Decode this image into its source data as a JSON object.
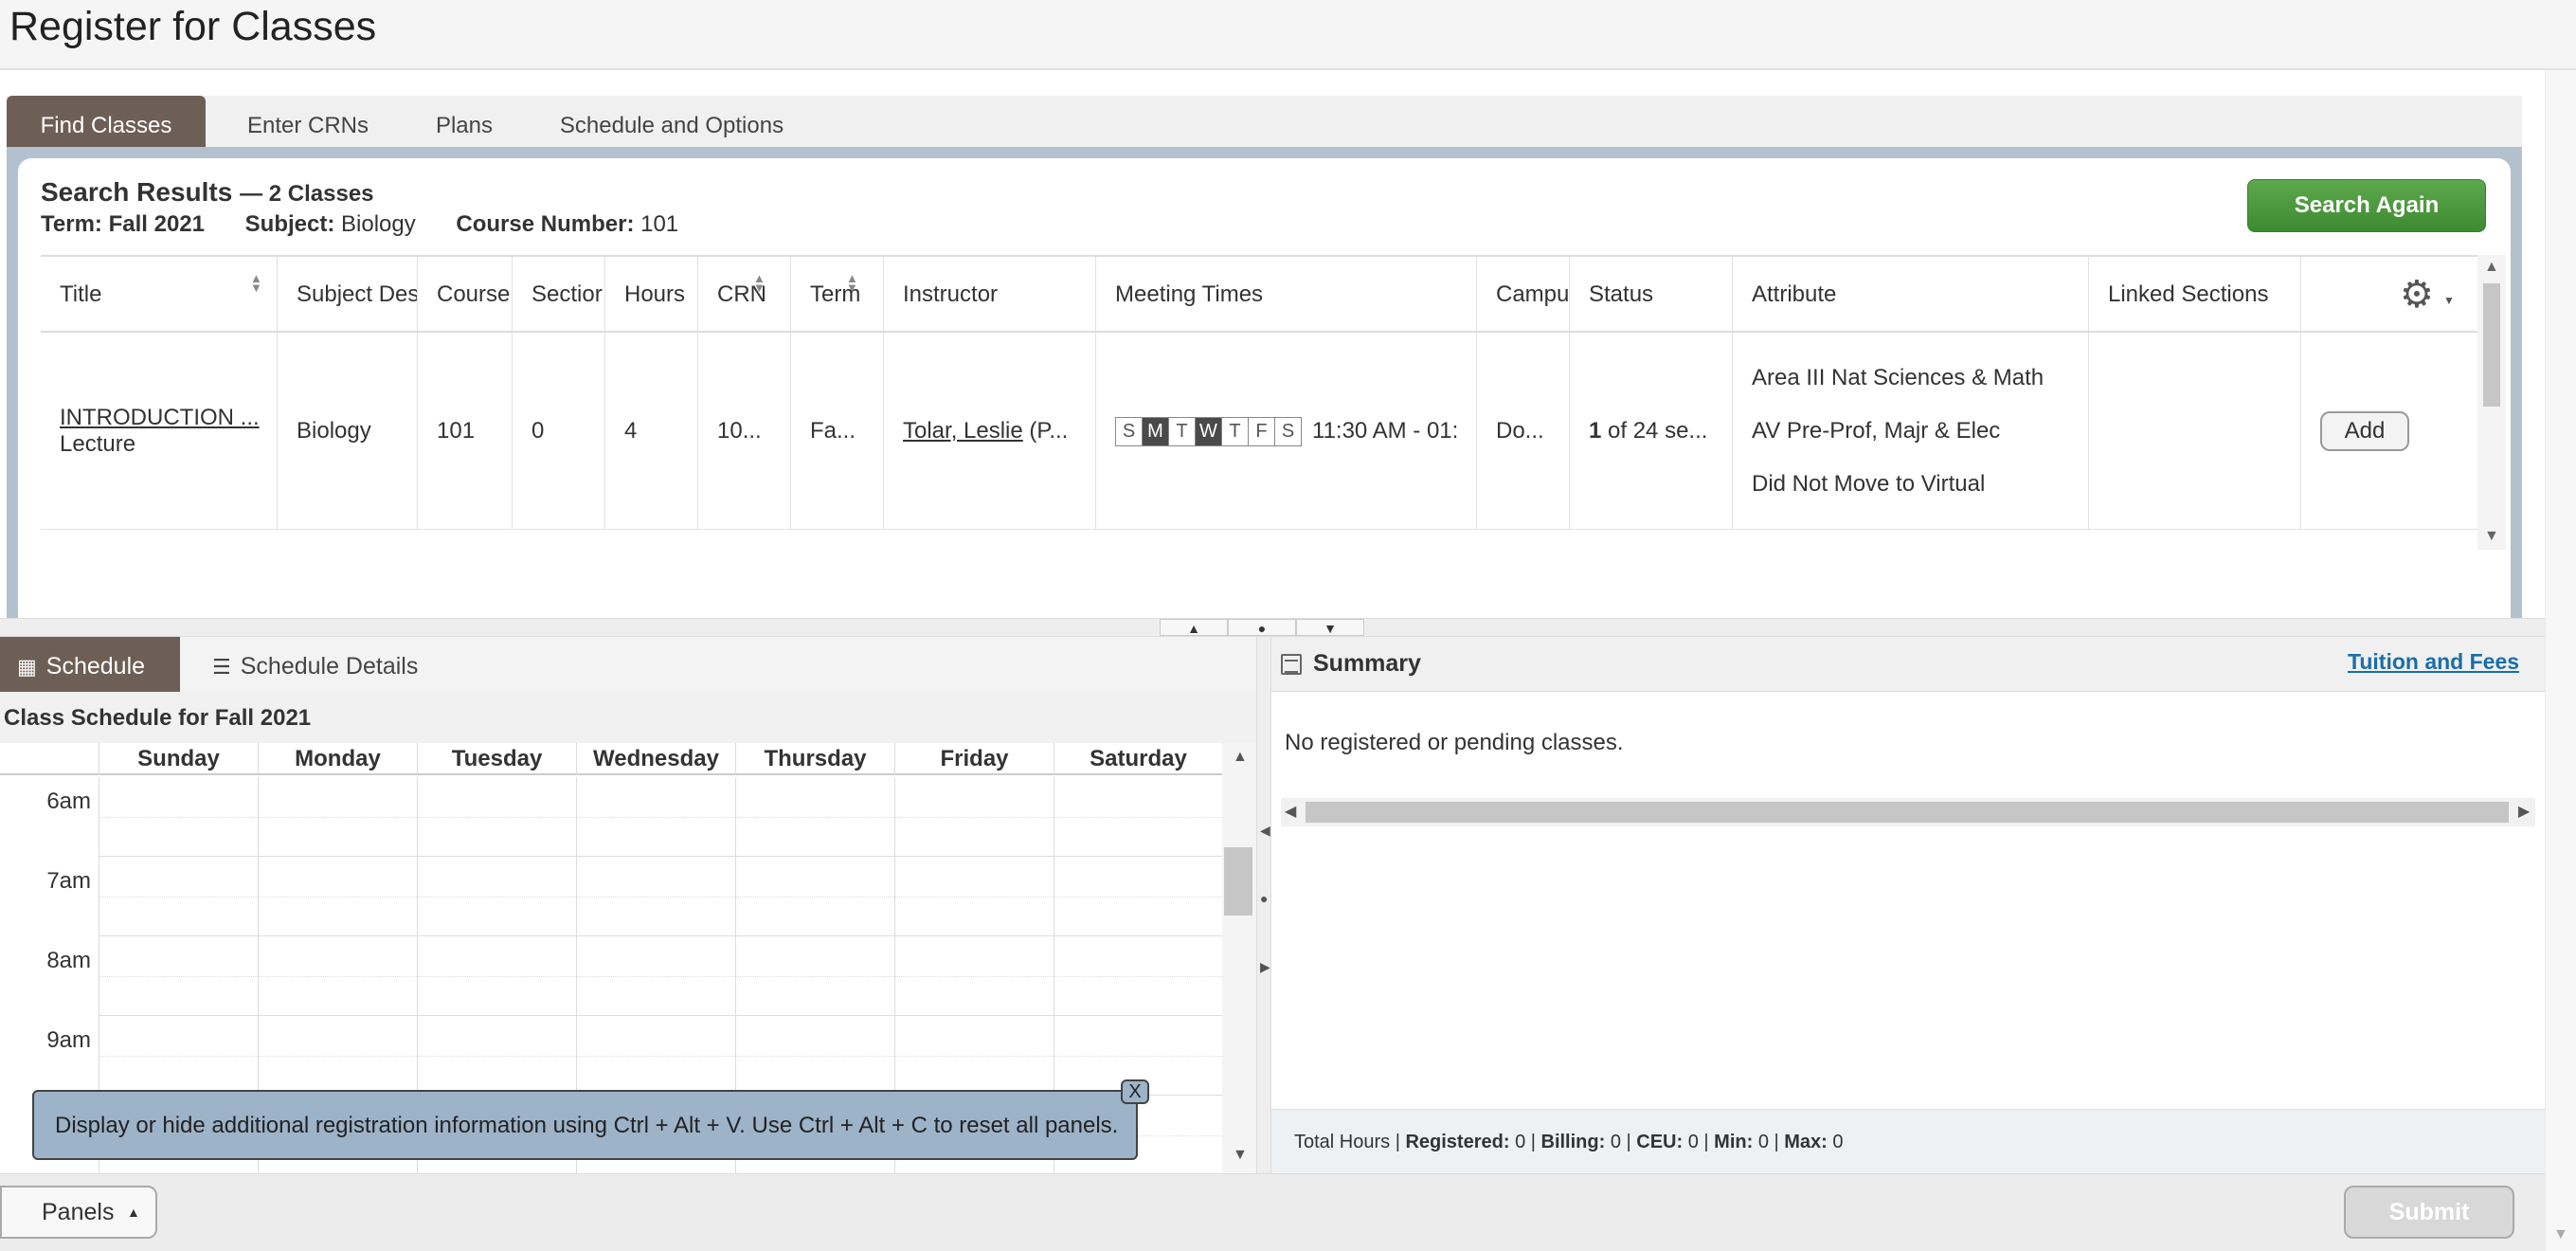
{
  "page": {
    "title": "Register for Classes"
  },
  "tabs": [
    "Find Classes",
    "Enter CRNs",
    "Plans",
    "Schedule and Options"
  ],
  "search": {
    "title": "Search Results",
    "count": "— 2 Classes",
    "term_label": "Term:",
    "term_value": "Fall 2021",
    "subject_label": "Subject:",
    "subject_value": "Biology",
    "course_label": "Course Number:",
    "course_value": "101",
    "search_again": "Search Again"
  },
  "table": {
    "headers": [
      "Title",
      "Subject Des",
      "Course",
      "Sectior",
      "Hours",
      "CRN",
      "Term",
      "Instructor",
      "Meeting Times",
      "Campu",
      "Status",
      "Attribute",
      "Linked Sections"
    ],
    "row": {
      "title": "INTRODUCTION ...",
      "type": "Lecture",
      "subject": "Biology",
      "course": "101",
      "section": "0",
      "hours": "4",
      "crn": "10...",
      "term": "Fa...",
      "instructor": "Tolar, Leslie",
      "instructor_suffix": " (P...",
      "days": [
        "S",
        "M",
        "T",
        "W",
        "T",
        "F",
        "S"
      ],
      "active_days": [
        1,
        3
      ],
      "time": "11:30 AM - 01:",
      "campus": "Do...",
      "status_num": "1",
      "status_text": " of 24 se...",
      "attributes": [
        "Area III Nat Sciences & Math",
        "AV Pre-Prof, Majr & Elec",
        "Did Not Move to Virtual"
      ],
      "add": "Add"
    }
  },
  "schedule": {
    "tab_schedule": "Schedule",
    "tab_details": "Schedule Details",
    "caption": "Class Schedule for Fall 2021",
    "days": [
      "Sunday",
      "Monday",
      "Tuesday",
      "Wednesday",
      "Thursday",
      "Friday",
      "Saturday"
    ],
    "times": [
      "6am",
      "7am",
      "8am",
      "9am",
      ""
    ]
  },
  "tooltip": {
    "text": "Display or hide additional registration information using Ctrl + Alt + V. Use Ctrl + Alt + C to reset all panels.",
    "close": "X"
  },
  "summary": {
    "title": "Summary",
    "tuition": "Tuition and Fees",
    "empty": "No registered or pending classes.",
    "total_hours": "Total Hours |",
    "registered_label": "Registered:",
    "registered": "0",
    "billing_label": "Billing:",
    "billing": "0",
    "ceu_label": "CEU:",
    "ceu": "0",
    "min_label": "Min:",
    "min": "0",
    "max_label": "Max:",
    "max": "0"
  },
  "footer": {
    "panels": "Panels",
    "submit": "Submit"
  },
  "colors": {
    "active_tab": "#6d5f55",
    "search_again": "#4a9a3e",
    "link": "#1a6ea8",
    "tooltip": "#9db3c8"
  }
}
